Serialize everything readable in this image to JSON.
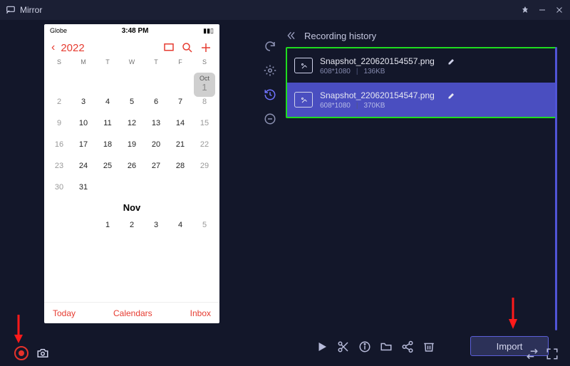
{
  "app": {
    "title": "Mirror"
  },
  "phone": {
    "carrier": "Globe",
    "time": "3:48 PM",
    "year": "2022",
    "dow": [
      "S",
      "M",
      "T",
      "W",
      "T",
      "F",
      "S"
    ],
    "oct_label": "Oct",
    "oct_day": "1",
    "rows": [
      [
        "2",
        "3",
        "4",
        "5",
        "6",
        "7",
        "8"
      ],
      [
        "9",
        "10",
        "11",
        "12",
        "13",
        "14",
        "15"
      ],
      [
        "16",
        "17",
        "18",
        "19",
        "20",
        "21",
        "22"
      ],
      [
        "23",
        "24",
        "25",
        "26",
        "27",
        "28",
        "29"
      ],
      [
        "30",
        "31",
        "",
        "",
        "",
        "",
        ""
      ]
    ],
    "next_month": "Nov",
    "nov_rows": [
      [
        "",
        "",
        "1",
        "2",
        "3",
        "4",
        "5"
      ]
    ],
    "footer": {
      "today": "Today",
      "calendars": "Calendars",
      "inbox": "Inbox"
    }
  },
  "panel": {
    "title": "Recording history",
    "items": [
      {
        "name": "Snapshot_220620154557.png",
        "res": "608*1080",
        "size": "136KB",
        "selected": false
      },
      {
        "name": "Snapshot_220620154547.png",
        "res": "608*1080",
        "size": "370KB",
        "selected": true
      }
    ],
    "import_label": "Import"
  }
}
